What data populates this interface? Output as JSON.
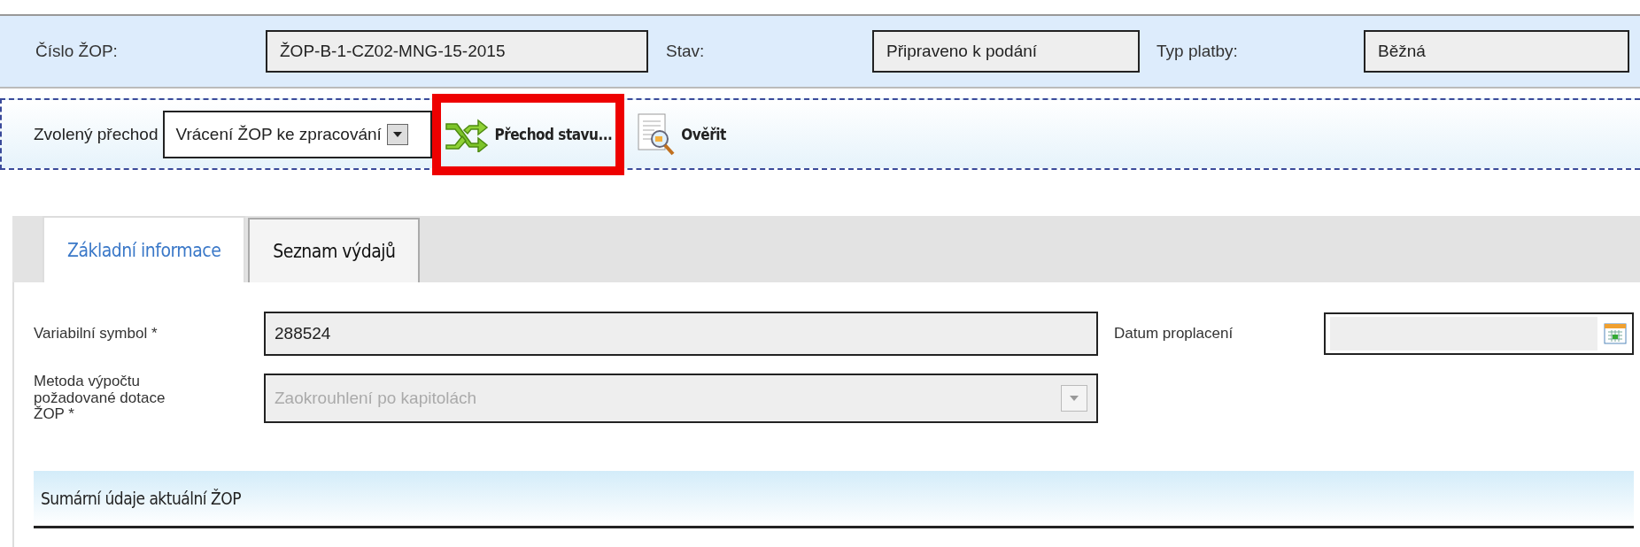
{
  "header": {
    "fields": [
      {
        "label": "Číslo ŽOP:",
        "value": "ŽOP-B-1-CZ02-MNG-15-2015"
      },
      {
        "label": "Stav:",
        "value": "Připraveno k podání"
      },
      {
        "label": "Typ platby:",
        "value": "Běžná"
      }
    ]
  },
  "toolbar": {
    "transition_label": "Zvolený přechod",
    "transition_select": {
      "value": "Vrácení ŽOP ke zpracování"
    },
    "buttons": [
      {
        "kind": "transition",
        "label": "Přechod stavu...",
        "highlighted": true
      },
      {
        "kind": "verify",
        "label": "Ověřit",
        "highlighted": false
      }
    ]
  },
  "tabs": [
    {
      "label": "Základní informace",
      "selected": true
    },
    {
      "label": "Seznam výdajů",
      "selected": false
    }
  ],
  "form": {
    "variable_symbol": {
      "label": "Variabilní symbol *",
      "value": "288524"
    },
    "payment_date": {
      "label": "Datum proplacení"
    },
    "method": {
      "label": "Metoda výpočtu požadované dotace ŽOP *",
      "value": "Zaokrouhlení po kapitolách",
      "disabled": true
    }
  },
  "summary": {
    "title": "Sumární údaje aktuální ŽOP"
  }
}
